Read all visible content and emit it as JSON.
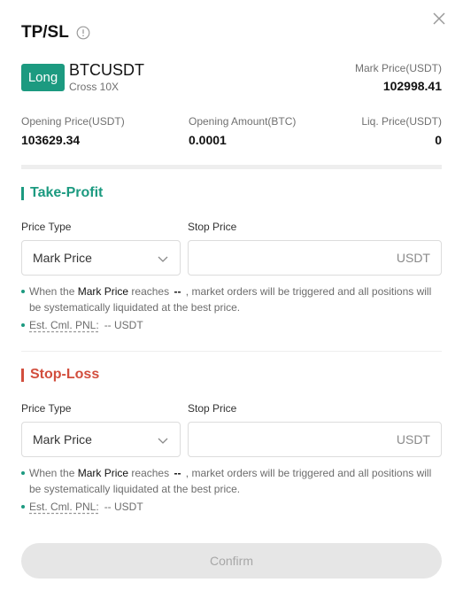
{
  "header": {
    "title": "TP/SL",
    "info_icon": "info-circle-icon",
    "close_icon": "close-icon"
  },
  "position": {
    "side": "Long",
    "side_color": "#1c9a80",
    "symbol": "BTCUSDT",
    "leverage": "Cross 10X",
    "mark_price_label": "Mark Price(USDT)",
    "mark_price": "102998.41"
  },
  "stats": [
    {
      "label": "Opening Price(USDT)",
      "value": "103629.34"
    },
    {
      "label": "Opening Amount(BTC)",
      "value": "0.0001"
    },
    {
      "label": "Liq. Price(USDT)",
      "value": "0"
    }
  ],
  "take_profit": {
    "title": "Take-Profit",
    "color": "#1c9a80",
    "price_type_label": "Price Type",
    "price_type_value": "Mark Price",
    "stop_price_label": "Stop Price",
    "stop_price_value": "",
    "unit": "USDT",
    "note_prefix": "When the",
    "note_price": "Mark Price",
    "note_reaches": "reaches",
    "note_dashes": "--",
    "note_suffix": ", market orders will be triggered and all positions will be systematically liquidated at the best price.",
    "pnl_label": "Est. Cml. PNL:",
    "pnl_value": "-- USDT"
  },
  "stop_loss": {
    "title": "Stop-Loss",
    "color": "#d24e3d",
    "price_type_label": "Price Type",
    "price_type_value": "Mark Price",
    "stop_price_label": "Stop Price",
    "stop_price_value": "",
    "unit": "USDT",
    "note_prefix": "When the",
    "note_price": "Mark Price",
    "note_reaches": "reaches",
    "note_dashes": "--",
    "note_suffix": ", market orders will be triggered and all positions will be systematically liquidated at the best price.",
    "pnl_label": "Est. Cml. PNL:",
    "pnl_value": "-- USDT"
  },
  "confirm_label": "Confirm"
}
